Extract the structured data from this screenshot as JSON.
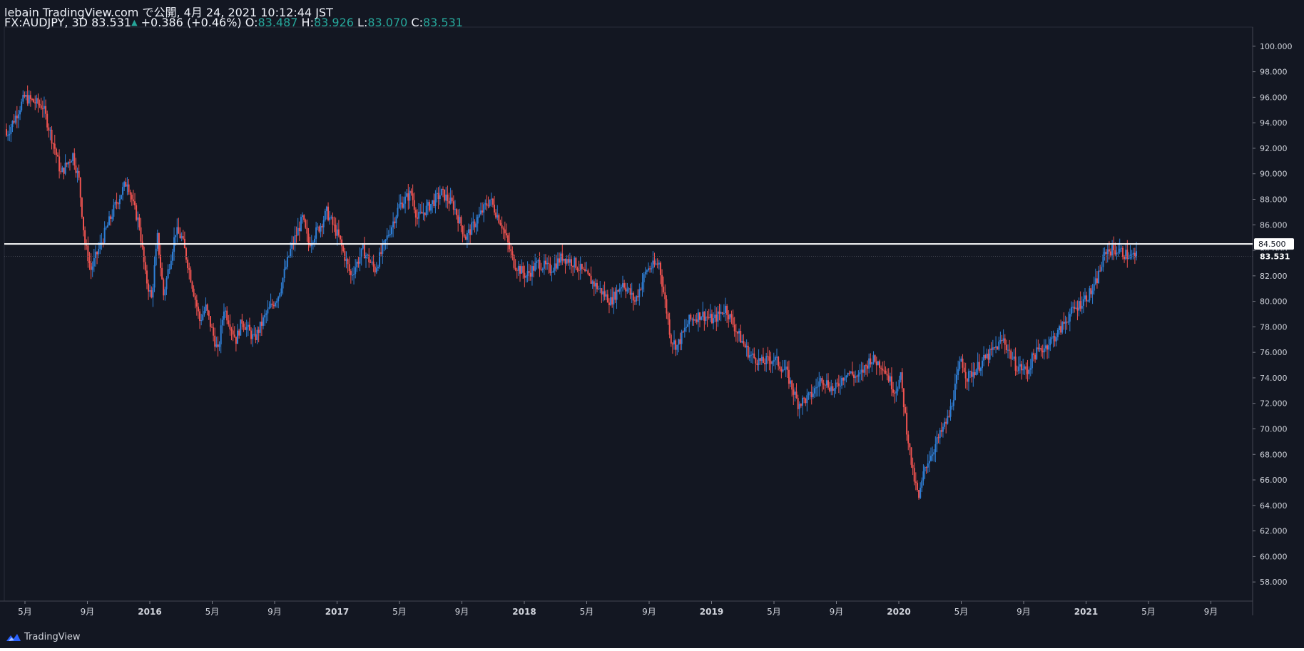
{
  "header": {
    "line1": "lebain TradingView.com で公開, 4月 24, 2021 10:12:44 JST",
    "symbol": "FX:AUDJPY, 3D",
    "last": "83.531",
    "change": "+0.386 (+0.46%)",
    "o_label": "O:",
    "o": "83.487",
    "h_label": "H:",
    "h": "83.926",
    "l_label": "L:",
    "l": "83.070",
    "c_label": "C:",
    "c": "83.531"
  },
  "brand": {
    "name": "TradingView",
    "icon": "tradingview-logo-icon"
  },
  "colors": {
    "background": "#131722",
    "up": "#2f7fd6",
    "down": "#ef5350",
    "text": "#d1d4dc",
    "hline": "#ffffff"
  },
  "chart_data": {
    "type": "candlestick",
    "symbol": "FX:AUDJPY",
    "interval": "3D",
    "ylim": [
      56.5,
      101.5
    ],
    "y_ticks": [
      "100.000",
      "98.000",
      "96.000",
      "94.000",
      "92.000",
      "90.000",
      "88.000",
      "86.000",
      "84.000",
      "82.000",
      "80.000",
      "78.000",
      "76.000",
      "74.000",
      "72.000",
      "70.000",
      "68.000",
      "66.000",
      "64.000",
      "62.000",
      "60.000",
      "58.000"
    ],
    "x_ticks": [
      "5月",
      "9月",
      "2016",
      "5月",
      "9月",
      "2017",
      "5月",
      "9月",
      "2018",
      "5月",
      "9月",
      "2019",
      "5月",
      "9月",
      "2020",
      "5月",
      "9月",
      "2021",
      "5月",
      "9月"
    ],
    "x_tick_bold": [
      false,
      false,
      true,
      false,
      false,
      true,
      false,
      false,
      true,
      false,
      false,
      true,
      false,
      false,
      true,
      false,
      false,
      true,
      false,
      false
    ],
    "horizontal_line": {
      "value": 84.5,
      "label": "84.500"
    },
    "last_price": {
      "value": 83.531,
      "label": "83.531"
    },
    "grid": false,
    "close_path": [
      [
        0,
        93.0
      ],
      [
        3,
        96.0
      ],
      [
        6,
        95.3
      ],
      [
        8,
        92.0
      ],
      [
        9,
        90.0
      ],
      [
        11,
        91.5
      ],
      [
        12,
        89.5
      ],
      [
        13,
        84.5
      ],
      [
        14,
        82.5
      ],
      [
        16,
        85.0
      ],
      [
        18,
        87.5
      ],
      [
        20,
        89.5
      ],
      [
        21,
        87.5
      ],
      [
        22,
        86.0
      ],
      [
        23,
        82.0
      ],
      [
        24,
        80.2
      ],
      [
        25,
        85.0
      ],
      [
        26,
        80.5
      ],
      [
        28,
        85.5
      ],
      [
        29,
        85.0
      ],
      [
        30,
        83.0
      ],
      [
        32,
        78.5
      ],
      [
        33,
        79.5
      ],
      [
        35,
        76.0
      ],
      [
        36,
        79.5
      ],
      [
        38,
        77.0
      ],
      [
        39,
        78.5
      ],
      [
        41,
        77.0
      ],
      [
        43,
        79.0
      ],
      [
        45,
        80.5
      ],
      [
        47,
        84.0
      ],
      [
        49,
        86.5
      ],
      [
        50,
        84.5
      ],
      [
        52,
        86.0
      ],
      [
        53,
        87.0
      ],
      [
        55,
        85.0
      ],
      [
        57,
        82.0
      ],
      [
        59,
        84.0
      ],
      [
        61,
        82.5
      ],
      [
        63,
        85.0
      ],
      [
        65,
        87.5
      ],
      [
        67,
        88.5
      ],
      [
        68,
        86.5
      ],
      [
        70,
        87.5
      ],
      [
        72,
        88.5
      ],
      [
        74,
        87.5
      ],
      [
        76,
        85.0
      ],
      [
        78,
        86.5
      ],
      [
        80,
        88.0
      ],
      [
        82,
        86.0
      ],
      [
        84,
        83.0
      ],
      [
        86,
        82.0
      ],
      [
        88,
        83.0
      ],
      [
        90,
        82.5
      ],
      [
        92,
        83.5
      ],
      [
        94,
        83.0
      ],
      [
        96,
        82.0
      ],
      [
        98,
        81.0
      ],
      [
        100,
        80.0
      ],
      [
        102,
        81.5
      ],
      [
        104,
        80.0
      ],
      [
        106,
        82.5
      ],
      [
        108,
        83.0
      ],
      [
        110,
        77.0
      ],
      [
        111,
        76.5
      ],
      [
        113,
        78.5
      ],
      [
        115,
        79.0
      ],
      [
        117,
        78.5
      ],
      [
        119,
        79.5
      ],
      [
        121,
        77.5
      ],
      [
        123,
        75.8
      ],
      [
        125,
        75.2
      ],
      [
        127,
        75.5
      ],
      [
        129,
        74.5
      ],
      [
        131,
        72.0
      ],
      [
        133,
        72.5
      ],
      [
        135,
        74.0
      ],
      [
        137,
        73.0
      ],
      [
        139,
        74.5
      ],
      [
        141,
        74.0
      ],
      [
        143,
        75.5
      ],
      [
        145,
        75.0
      ],
      [
        147,
        73.0
      ],
      [
        148,
        74.0
      ],
      [
        149,
        70.0
      ],
      [
        150,
        66.5
      ],
      [
        151,
        64.5
      ],
      [
        152,
        67.0
      ],
      [
        154,
        69.0
      ],
      [
        156,
        71.0
      ],
      [
        158,
        75.5
      ],
      [
        159,
        74.0
      ],
      [
        161,
        75.0
      ],
      [
        163,
        76.0
      ],
      [
        165,
        77.0
      ],
      [
        167,
        75.0
      ],
      [
        169,
        74.5
      ],
      [
        170,
        75.8
      ],
      [
        172,
        76.5
      ],
      [
        174,
        77.5
      ],
      [
        176,
        79.0
      ],
      [
        178,
        80.0
      ],
      [
        180,
        81.0
      ],
      [
        182,
        84.0
      ],
      [
        184,
        84.0
      ],
      [
        186,
        83.5
      ],
      [
        187,
        83.531
      ]
    ]
  }
}
